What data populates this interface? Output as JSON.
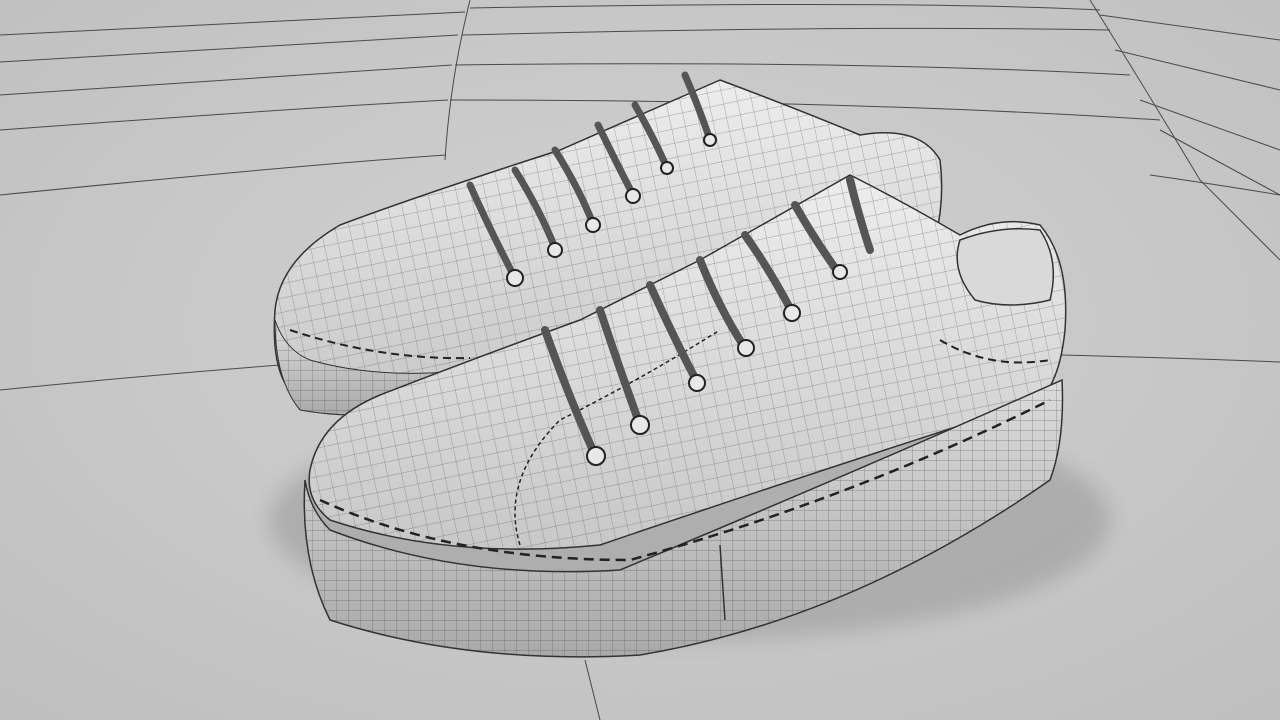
{
  "scene": {
    "subject": "sneakers-wireframe-render",
    "colors": {
      "floor": "#c9c9c9",
      "floor_dark": "#b5b5b5",
      "shoe_light": "#e6e6e6",
      "shoe_mid": "#cfcfcf",
      "shoe_shadow": "#9a9a9a",
      "wire": "#3a3a3a",
      "grid": "#555555"
    }
  }
}
